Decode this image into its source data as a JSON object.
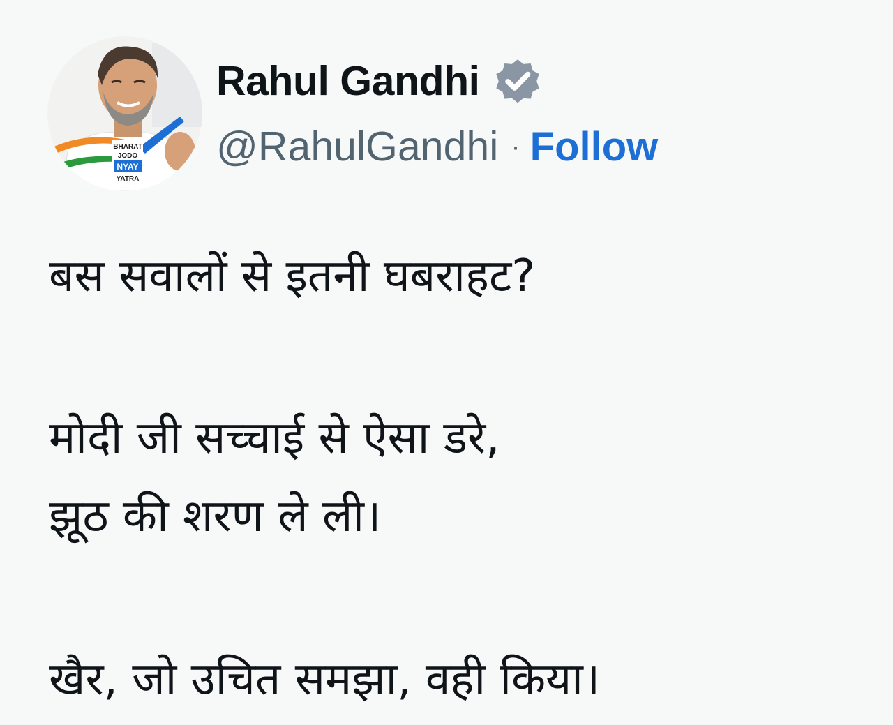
{
  "author": {
    "display_name": "Rahul Gandhi",
    "handle": "@RahulGandhi",
    "separator": "·",
    "follow_label": "Follow",
    "verified_badge_icon": "verified-badge-icon",
    "avatar_badge_text": [
      "BHARAT",
      "JODO",
      "NYAY",
      "YATRA"
    ]
  },
  "tweet": {
    "lines": [
      "बस सवालों से इतनी घबराहट?",
      "मोदी जी सच्चाई से ऐसा डरे,",
      "झूठ की शरण ले ली।",
      "खैर, जो उचित समझा, वही किया।"
    ]
  },
  "colors": {
    "background": "#f7f8f8",
    "text": "#0f1419",
    "secondary_text": "#536471",
    "follow_link": "#1d6fd6",
    "badge": "#8a96a3"
  }
}
